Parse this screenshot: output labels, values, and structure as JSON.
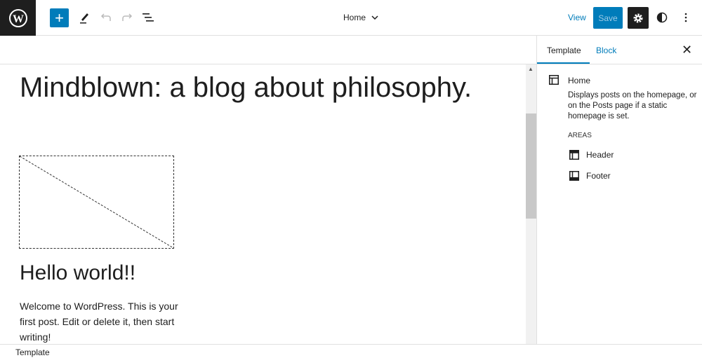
{
  "toolbar": {
    "page_selector": "Home",
    "view_label": "View",
    "save_label": "Save"
  },
  "canvas": {
    "site_title": "Mindblown: a blog about philosophy.",
    "post_title": "Hello world!!",
    "post_excerpt": "Welcome to WordPress. This is your first post. Edit or delete it, then start writing!"
  },
  "sidebar": {
    "tabs": [
      {
        "label": "Template"
      },
      {
        "label": "Block"
      }
    ],
    "template_name": "Home",
    "template_description": "Displays posts on the homepage, or on the Posts page if a static homepage is set.",
    "areas_heading": "AREAS",
    "areas": [
      {
        "label": "Header"
      },
      {
        "label": "Footer"
      }
    ]
  },
  "footer": {
    "breadcrumb": "Template"
  },
  "colors": {
    "accent": "#007cba",
    "dark": "#1e1e1e"
  }
}
